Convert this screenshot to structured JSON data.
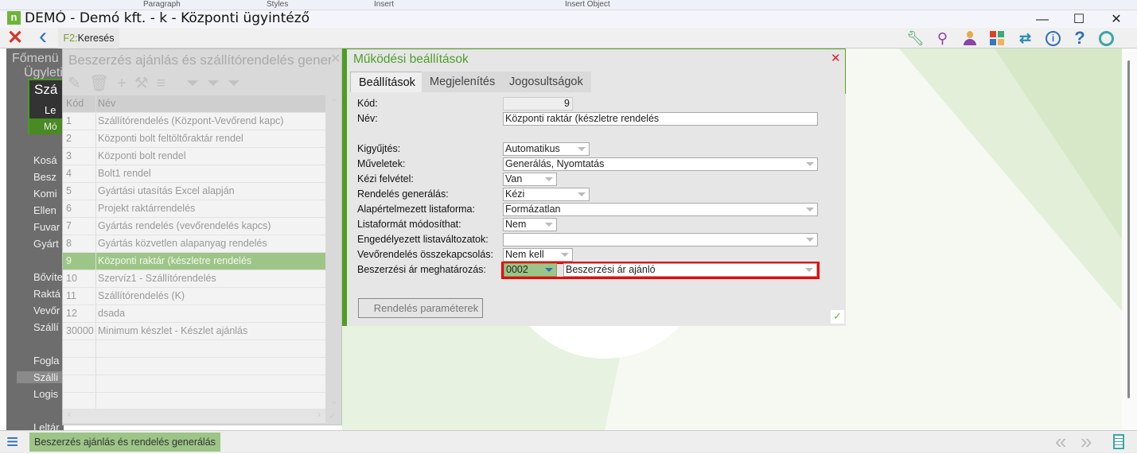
{
  "ribbon": {
    "groups": [
      "Paragraph",
      "Styles",
      "Insert",
      "Insert Object"
    ]
  },
  "window": {
    "logo": "n",
    "title": "DEMÓ - Demó kft. - k - Központi ügyintéző",
    "minimize": "—",
    "maximize": "☐",
    "close": "✕"
  },
  "toolbar": {
    "close_icon": "✕",
    "back_icon": "‹",
    "search_key": "F2:",
    "search_label": "Keresés",
    "right_icons": [
      "wrench-icon",
      "search-icon",
      "user-icon",
      "apps-icon",
      "transfer-icon",
      "info-icon",
      "help-icon",
      "circle-icon"
    ]
  },
  "sidebar": {
    "header": "Főmenü",
    "sub": "Ügyleti",
    "box_title": "Szá",
    "box_line": "Le",
    "box_btn": "Mó",
    "items": [
      "Kosá",
      "Besz",
      "Komi",
      "Ellen",
      "Fuvar",
      "Gyárt",
      "Bővíte",
      "Raktá",
      "Vevőr",
      "Szállí",
      "Fogla",
      "Szálli",
      "Logis",
      "Leltár"
    ]
  },
  "list_window": {
    "title": "Beszerzés ajánlás és szállítórendelés generálás",
    "columns": [
      "Kód",
      "Név"
    ],
    "rows": [
      [
        "1",
        "Szállítórendelés (Központ-Vevőrend kapc)"
      ],
      [
        "2",
        "Központi bolt feltöltőraktár rendel"
      ],
      [
        "3",
        "Központi bolt rendel"
      ],
      [
        "4",
        "Bolt1 rendel"
      ],
      [
        "5",
        "Gyártási utasítás Excel alapján"
      ],
      [
        "6",
        "Projekt raktárrendelés"
      ],
      [
        "7",
        "Gyártás rendelés (vevőrendelés kapcs)"
      ],
      [
        "8",
        "Gyártás közvetlen alapanyag rendelés"
      ],
      [
        "9",
        "Központi raktár (készletre rendelés"
      ],
      [
        "10",
        "Szervíz1 - Szállítórendelés"
      ],
      [
        "11",
        "Szállítórendelés (K)"
      ],
      [
        "12",
        "dsada"
      ],
      [
        "30000",
        "Minimum készlet - Készlet ajánlás"
      ]
    ],
    "selected_code": "9"
  },
  "dialog": {
    "title": "Működési beállítások",
    "close": "✕",
    "tabs": [
      "Beállítások",
      "Megjelenítés",
      "Jogosultságok"
    ],
    "active_tab": "Beállítások",
    "fields": {
      "kod_label": "Kód:",
      "kod": "9",
      "nev_label": "Név:",
      "nev": "Központi raktár (készletre rendelés",
      "kigyujtes_label": "Kigyűjtés:",
      "kigyujtes": "Automatikus",
      "muveletek_label": "Műveletek:",
      "muveletek": "Generálás, Nyomtatás",
      "kezi_label": "Kézi felvétel:",
      "kezi": "Van",
      "rendgen_label": "Rendelés generálás:",
      "rendgen": "Kézi",
      "listaforma_label": "Alapértelmezett listaforma:",
      "listaforma": "Formázatlan",
      "listamod_label": "Listaformát módosíthat:",
      "listamod": "Nem",
      "listavalt_label": "Engedélyezett listaváltozatok:",
      "listavalt": "",
      "vevo_label": "Vevőrendelés összekapcsolás:",
      "vevo": "Nem kell",
      "beszar_label": "Beszerzési ár meghatározás:",
      "beszar_code": "0002",
      "beszar": "Beszerzési ár ajánló"
    },
    "button": "Rendelés paraméterek",
    "ok_icon": "✓"
  },
  "bottom": {
    "menu_icon": "≡",
    "active_tab": "Beszerzés ajánlás és rendelés generálás",
    "prev": "«",
    "next": "»"
  }
}
